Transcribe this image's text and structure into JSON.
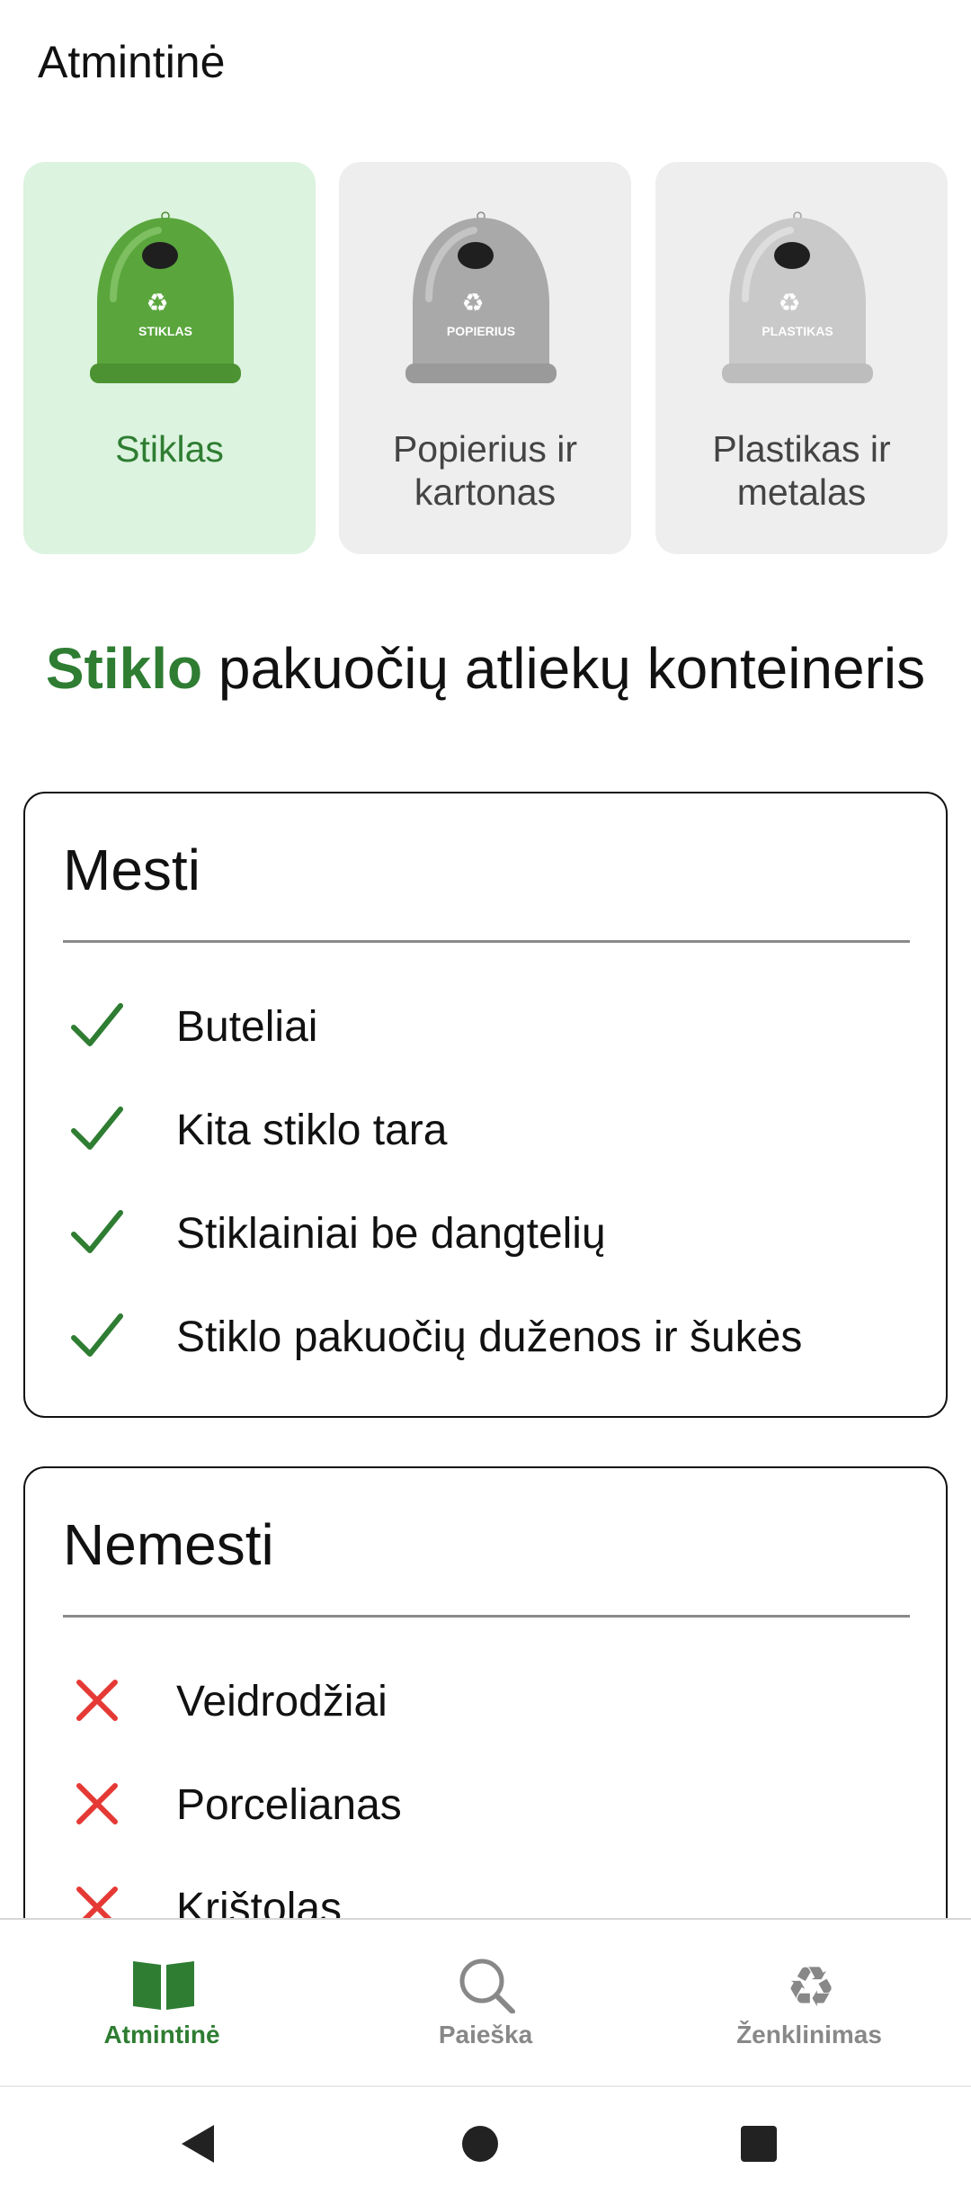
{
  "header": {
    "title": "Atmintinė"
  },
  "categories": [
    {
      "label": "Stiklas",
      "bin_text": "STIKLAS",
      "active": true,
      "color": "#5aa63d"
    },
    {
      "label": "Popierius ir kartonas",
      "bin_text": "POPIERIUS",
      "active": false,
      "color": "#a9a9a9"
    },
    {
      "label": "Plastikas ir metalas",
      "bin_text": "PLASTIKAS",
      "active": false,
      "color": "#c9c9c9"
    }
  ],
  "heading": {
    "highlight": "Stiklo",
    "rest": " pakuočių atliekų konteineris"
  },
  "allowed": {
    "title": "Mesti",
    "items": [
      "Buteliai",
      "Kita stiklo tara",
      "Stiklainiai be dangtelių",
      "Stiklo pakuočių duženos ir šukės"
    ],
    "icon": "check-icon",
    "color": "#2e7d32"
  },
  "not_allowed": {
    "title": "Nemesti",
    "items": [
      "Veidrodžiai",
      "Porcelianas",
      "Krištolas"
    ],
    "icon": "cross-icon",
    "color": "#e53935"
  },
  "bottom_nav": [
    {
      "label": "Atmintinė",
      "icon": "book-icon",
      "active": true
    },
    {
      "label": "Paieška",
      "icon": "search-icon",
      "active": false
    },
    {
      "label": "Ženklinimas",
      "icon": "recycle-icon",
      "active": false
    }
  ],
  "system_nav": [
    "back-icon",
    "home-icon",
    "recents-icon"
  ]
}
